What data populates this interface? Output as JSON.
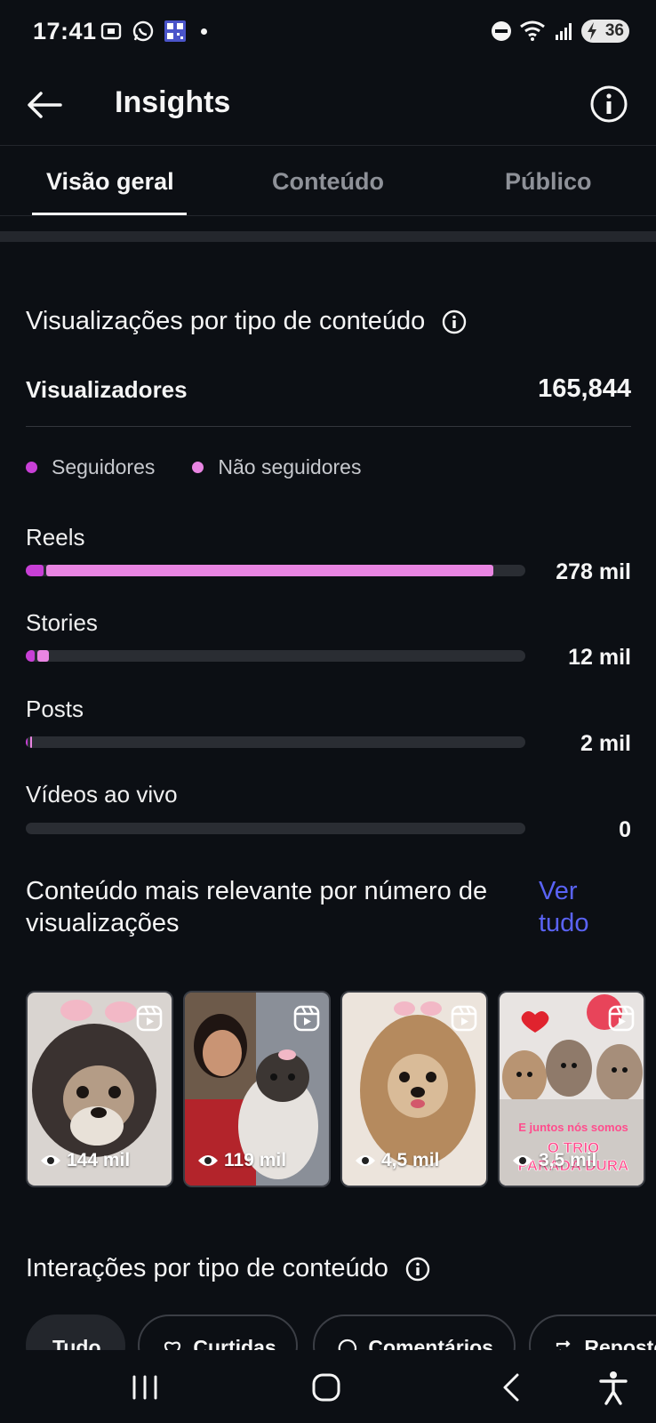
{
  "status_bar": {
    "time": "17:41",
    "battery": "36"
  },
  "header": {
    "title": "Insights"
  },
  "tabs": [
    {
      "label": "Visão geral",
      "active": true
    },
    {
      "label": "Conteúdo",
      "active": false
    },
    {
      "label": "Público",
      "active": false
    }
  ],
  "views_section": {
    "title": "Visualizações por tipo de conteúdo",
    "viewers_label": "Visualizadores",
    "viewers_value": "165,844",
    "legend": [
      {
        "label": "Seguidores",
        "color": "#c83fd6"
      },
      {
        "label": "Não seguidores",
        "color": "#e985e2"
      }
    ],
    "metrics": [
      {
        "label": "Reels",
        "value": "278 mil",
        "followers_pct": 3.5,
        "non_followers_pct": 89.5
      },
      {
        "label": "Stories",
        "value": "12 mil",
        "followers_pct": 1.8,
        "non_followers_pct": 2.4
      },
      {
        "label": "Posts",
        "value": "2 mil",
        "followers_pct": 0.4,
        "non_followers_pct": 0.3
      },
      {
        "label": "Vídeos ao vivo",
        "value": "0",
        "followers_pct": 0,
        "non_followers_pct": 0
      }
    ]
  },
  "top_content": {
    "title": "Conteúdo mais relevante por número de visualizações",
    "see_all": "Ver tudo",
    "items": [
      {
        "views": "144 mil"
      },
      {
        "views": "119 mil"
      },
      {
        "views": "4,5 mil"
      },
      {
        "views": "3,5 mil",
        "overlay_text_1": "E juntos nós somos",
        "overlay_text_2": "O TRIO",
        "overlay_text_3": "PARADA DURA"
      }
    ]
  },
  "interactions_section": {
    "title": "Interações por tipo de conteúdo",
    "chips": [
      {
        "label": "Tudo",
        "active": true
      },
      {
        "label": "Curtidas",
        "icon": "heart-icon"
      },
      {
        "label": "Comentários",
        "icon": "comment-icon"
      },
      {
        "label": "Repostos",
        "icon": "repost-icon"
      }
    ]
  },
  "colors": {
    "background": "#0c0f14",
    "accent_link": "#5a63f5",
    "followers": "#c83fd6",
    "non_followers": "#e985e2"
  }
}
